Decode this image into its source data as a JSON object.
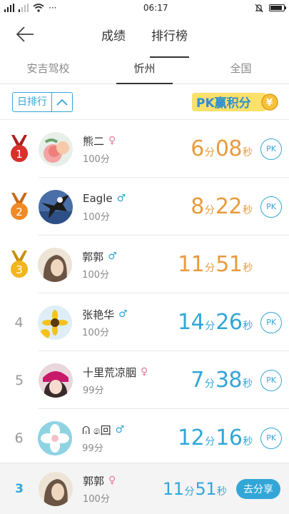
{
  "status": {
    "time": "06:17",
    "dots": "···"
  },
  "header": {
    "tabs": [
      "成绩",
      "排行榜"
    ]
  },
  "subtabs": [
    "安吉驾校",
    "忻州",
    "全国"
  ],
  "filter": {
    "label": "日排行"
  },
  "pk_banner": {
    "text": "PK赢积分"
  },
  "ranking": [
    {
      "rank": "1",
      "name": "熊二",
      "gender": "female",
      "score": "100分",
      "min": "6",
      "sec": "08",
      "min_unit": "分",
      "sec_unit": "秒",
      "pk": "PK"
    },
    {
      "rank": "2",
      "name": "Eagle",
      "gender": "male",
      "score": "100分",
      "min": "8",
      "sec": "22",
      "min_unit": "分",
      "sec_unit": "秒",
      "pk": "PK"
    },
    {
      "rank": "3",
      "name": "郭郭",
      "gender": "male",
      "score": "100分",
      "min": "11",
      "sec": "51",
      "min_unit": "分",
      "sec_unit": "秒",
      "pk": ""
    },
    {
      "rank": "4",
      "name": "张艳华",
      "gender": "male",
      "score": "100分",
      "min": "14",
      "sec": "26",
      "min_unit": "分",
      "sec_unit": "秒",
      "pk": "PK"
    },
    {
      "rank": "5",
      "name": "十里荒凉胭",
      "gender": "female",
      "score": "99分",
      "min": "7",
      "sec": "38",
      "min_unit": "分",
      "sec_unit": "秒",
      "pk": "PK"
    },
    {
      "rank": "6",
      "name": "ᕬ ෧回",
      "gender": "male",
      "score": "99分",
      "min": "12",
      "sec": "16",
      "min_unit": "分",
      "sec_unit": "秒",
      "pk": "PK"
    }
  ],
  "me": {
    "rank": "3",
    "name": "郭郭",
    "gender": "female",
    "score": "100分",
    "min": "11",
    "sec": "51",
    "min_unit": "分",
    "sec_unit": "秒",
    "share": "去分享"
  },
  "symbols": {
    "male": "♂",
    "female": "♀"
  },
  "colors": {
    "accent": "#33a6d8",
    "gold_time": "#e89b3d",
    "medal_red": "#d9302c",
    "medal_orange": "#ef8a24",
    "medal_yellow": "#f2b51b"
  }
}
